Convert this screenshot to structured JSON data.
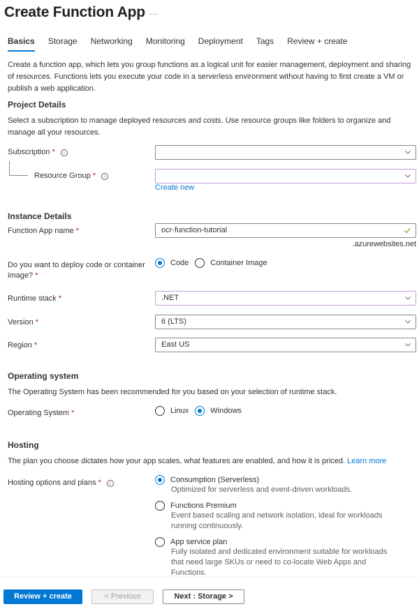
{
  "header": {
    "title": "Create Function App",
    "more_label": "..."
  },
  "tabs": [
    {
      "label": "Basics",
      "active": true
    },
    {
      "label": "Storage",
      "active": false
    },
    {
      "label": "Networking",
      "active": false
    },
    {
      "label": "Monitoring",
      "active": false
    },
    {
      "label": "Deployment",
      "active": false
    },
    {
      "label": "Tags",
      "active": false
    },
    {
      "label": "Review + create",
      "active": false
    }
  ],
  "intro": "Create a function app, which lets you group functions as a logical unit for easier management, deployment and sharing of resources. Functions lets you execute your code in a serverless environment without having to first create a VM or publish a web application.",
  "project": {
    "heading": "Project Details",
    "description": "Select a subscription to manage deployed resources and costs. Use resource groups like folders to organize and manage all your resources.",
    "subscription_label": "Subscription",
    "subscription_value": "",
    "resource_group_label": "Resource Group",
    "resource_group_value": "",
    "create_new_label": "Create new"
  },
  "instance": {
    "heading": "Instance Details",
    "app_name_label": "Function App name",
    "app_name_value": "ocr-function-tutorial",
    "domain_suffix": ".azurewebsites.net",
    "deploy_label": "Do you want to deploy code or container image?",
    "deploy_options": [
      {
        "label": "Code",
        "selected": true
      },
      {
        "label": "Container Image",
        "selected": false
      }
    ],
    "runtime_label": "Runtime stack",
    "runtime_value": ".NET",
    "version_label": "Version",
    "version_value": "6 (LTS)",
    "region_label": "Region",
    "region_value": "East US"
  },
  "os": {
    "heading": "Operating system",
    "description": "The Operating System has been recommended for you based on your selection of runtime stack.",
    "label": "Operating System",
    "options": [
      {
        "label": "Linux",
        "selected": false
      },
      {
        "label": "Windows",
        "selected": true
      }
    ]
  },
  "hosting": {
    "heading": "Hosting",
    "description": "The plan you choose dictates how your app scales, what features are enabled, and how it is priced.",
    "learn_more_label": "Learn more",
    "label": "Hosting options and plans",
    "plans": [
      {
        "title": "Consumption (Serverless)",
        "description": "Optimized for serverless and event-driven workloads.",
        "selected": true
      },
      {
        "title": "Functions Premium",
        "description": "Event based scaling and network isolation, ideal for workloads running continuously.",
        "selected": false
      },
      {
        "title": "App service plan",
        "description": "Fully isolated and dedicated environment suitable for workloads that need large SKUs or need to co-locate Web Apps and Functions.",
        "selected": false
      }
    ]
  },
  "footer": {
    "review_create_label": "Review + create",
    "previous_label": "< Previous",
    "next_label": "Next : Storage >"
  },
  "required_marker": "*",
  "colors": {
    "accent": "#0078d4",
    "required": "#a4262c",
    "valid": "#57a300",
    "focus_border": "#c19fd6"
  }
}
